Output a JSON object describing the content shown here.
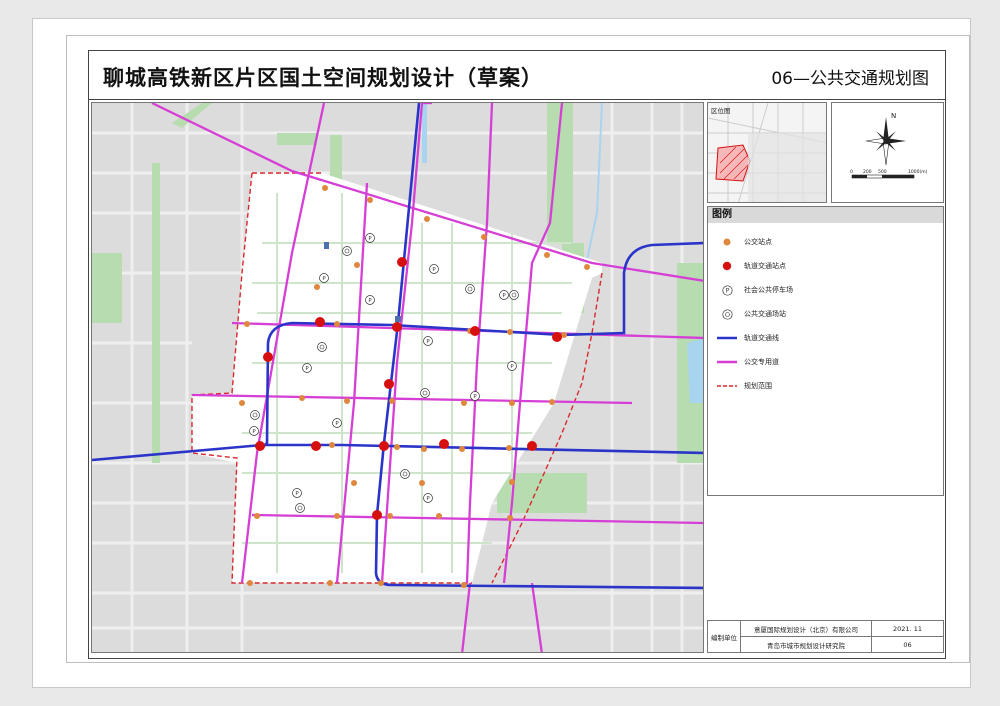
{
  "document": {
    "title": "聊城高铁新区片区国土空间规划设计（草案）",
    "sheet_title": "06—公共交通规划图"
  },
  "inset_map": {
    "label": "区位图"
  },
  "compass": {
    "north_label": "N",
    "scale_ticks": [
      "0",
      "200",
      "500",
      "1000(m)"
    ]
  },
  "legend": {
    "title": "图例",
    "items": [
      {
        "label": "公交站点",
        "symbol": "bus-stop",
        "color": "#e0873e"
      },
      {
        "label": "轨道交通站点",
        "symbol": "rail-station",
        "color": "#d60f0f"
      },
      {
        "label": "社会公共停车场",
        "symbol": "parking",
        "glyph": "P"
      },
      {
        "label": "公共交通场站",
        "symbol": "bus-depot",
        "glyph": "◎"
      },
      {
        "label": "轨道交通线",
        "symbol": "rail-line",
        "color": "#2a34c9"
      },
      {
        "label": "公交专用道",
        "symbol": "bus-lane",
        "color": "#d63fd6"
      },
      {
        "label": "规划范围",
        "symbol": "plan-boundary",
        "color": "#d9292e"
      }
    ]
  },
  "signature": {
    "unit_label": "编制单位",
    "company_1": "意厦国际规划设计（北京）有限公司",
    "company_2": "青岛市城市规划设计研究院",
    "date": "2021. 11",
    "sheet_no": "06"
  },
  "colors": {
    "rail_line": "#2a34c9",
    "bus_lane": "#d63fd6",
    "bus_stop": "#e0873e",
    "rail_station": "#d60f0f",
    "boundary": "#d9292e",
    "green_space": "#b6dcb0",
    "water": "#a9d4ef"
  }
}
